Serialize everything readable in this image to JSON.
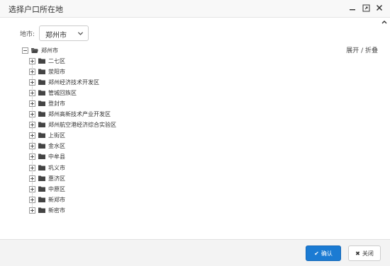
{
  "dialog": {
    "title": "选择户口所在地",
    "minimize_icon": "minimize-icon",
    "maximize_icon": "maximize-icon",
    "close_icon": "close-icon"
  },
  "region": {
    "label": "地市:",
    "selected": "郑州市"
  },
  "tree": {
    "toggle_label": "展开 / 折叠",
    "root": {
      "label": "郑州市",
      "expanded": true
    },
    "children": [
      {
        "label": "二七区"
      },
      {
        "label": "荥阳市"
      },
      {
        "label": "郑州经济技术开发区"
      },
      {
        "label": "管城回族区"
      },
      {
        "label": "登封市"
      },
      {
        "label": "郑州高新技术产业开发区"
      },
      {
        "label": "郑州航空港经济综合实验区"
      },
      {
        "label": "上街区"
      },
      {
        "label": "金水区"
      },
      {
        "label": "中牟县"
      },
      {
        "label": "巩义市"
      },
      {
        "label": "惠济区"
      },
      {
        "label": "中原区"
      },
      {
        "label": "新郑市"
      },
      {
        "label": "新密市"
      }
    ]
  },
  "footer": {
    "ok_label": "确认",
    "close_label": "关闭"
  },
  "colors": {
    "primary": "#1b7bd3",
    "titlebar": "#f8f8f8",
    "footer": "#f3f3f3"
  }
}
